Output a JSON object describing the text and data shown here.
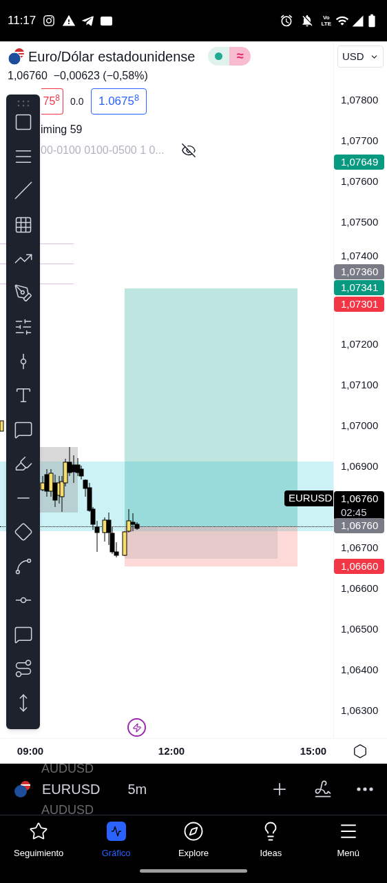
{
  "status_bar": {
    "time": "11:17",
    "network_label": [
      "Vo",
      "LTE"
    ]
  },
  "header": {
    "title": "Euro/Dólar estadounidense",
    "status_symbol": "≈",
    "quote": "1,06760  −0,00623 (−0,58%)",
    "sell": "75$^{8}$",
    "spread": "0.0",
    "buy": "1.0675$^{8}$",
    "indicator": "iming 59",
    "sessions": "00-0100 0100-0500 1 0...",
    "currency": "USD"
  },
  "price_axis": [
    "1,07800",
    "1,07700",
    "1,07600",
    "1,07500",
    "1,07400",
    "1,07200",
    "1,07100",
    "1,07000",
    "1,06900",
    "1,06700",
    "1,06600",
    "1,06500",
    "1,06400",
    "1,06300"
  ],
  "price_badges": [
    {
      "text": "1,07649",
      "color": "#089981"
    },
    {
      "text": "1,07360",
      "color": "#787b86"
    },
    {
      "text": "1,07341",
      "color": "#089981"
    },
    {
      "text": "1,07301",
      "color": "#f23645"
    },
    {
      "text": "1,06760",
      "sub": "02:45",
      "color": "#000000"
    },
    {
      "text": "1,06760",
      "color": "#787b86"
    },
    {
      "text": "1,06660",
      "color": "#f23645"
    }
  ],
  "symbol_label": "EURUSD",
  "time_axis": [
    "09:00",
    "12:00",
    "15:00"
  ],
  "symbol_bar": {
    "symbol": "EURUSD",
    "interval": "5m",
    "ghost_above": "AUDUSD",
    "ghost_below": "AUDUSD"
  },
  "nav": [
    {
      "label": "Seguimiento",
      "selected": false
    },
    {
      "label": "Gráfico",
      "selected": true
    },
    {
      "label": "Explore",
      "selected": false
    },
    {
      "label": "Ideas",
      "selected": false
    },
    {
      "label": "Menú",
      "selected": false
    }
  ]
}
